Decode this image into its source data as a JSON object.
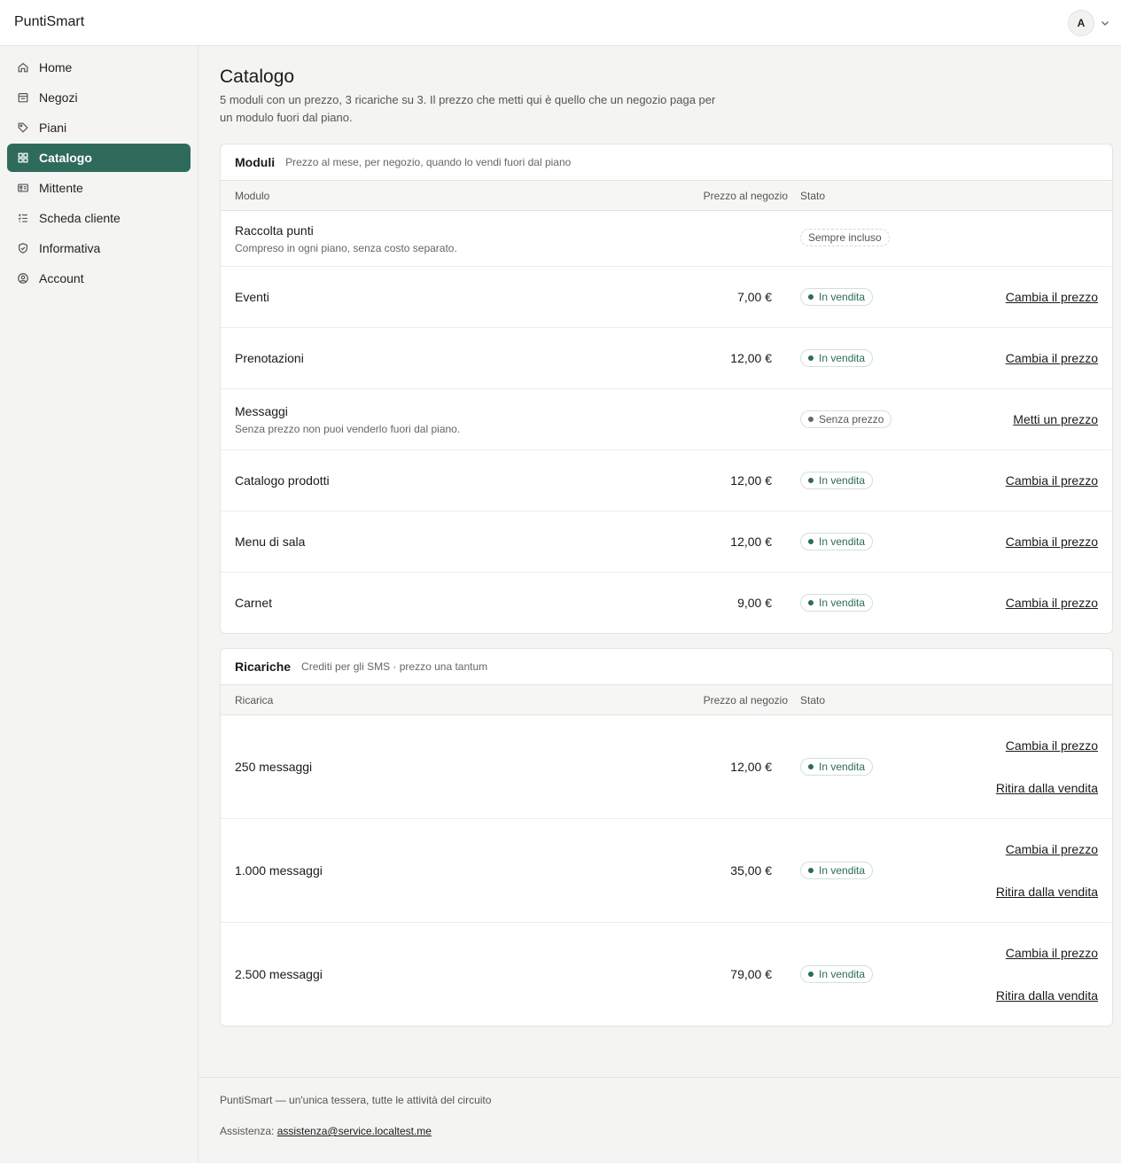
{
  "app": {
    "brand": "PuntiSmart",
    "user_initial": "A"
  },
  "sidebar": {
    "items": [
      {
        "label": "Home",
        "icon": "home-icon",
        "active": false
      },
      {
        "label": "Negozi",
        "icon": "store-icon",
        "active": false
      },
      {
        "label": "Piani",
        "icon": "tag-icon",
        "active": false
      },
      {
        "label": "Catalogo",
        "icon": "grid-icon",
        "active": true
      },
      {
        "label": "Mittente",
        "icon": "id-card-icon",
        "active": false
      },
      {
        "label": "Scheda cliente",
        "icon": "checklist-icon",
        "active": false
      },
      {
        "label": "Informativa",
        "icon": "shield-icon",
        "active": false
      },
      {
        "label": "Account",
        "icon": "user-circle-icon",
        "active": false
      }
    ]
  },
  "page": {
    "title": "Catalogo",
    "subtitle": "5 moduli con un prezzo, 3 ricariche su 3. Il prezzo che metti qui è quello che un negozio paga per un modulo fuori dal piano."
  },
  "modules": {
    "title": "Moduli",
    "description": "Prezzo al mese, per negozio, quando lo vendi fuori dal piano",
    "columns": {
      "name": "Modulo",
      "price": "Prezzo al negozio",
      "status": "Stato"
    },
    "rows": [
      {
        "name": "Raccolta punti",
        "note": "Compreso in ogni piano, senza costo separato.",
        "price": "",
        "status": "Sempre incluso",
        "status_kind": "included",
        "action": ""
      },
      {
        "name": "Eventi",
        "note": "",
        "price": "7,00 €",
        "status": "In vendita",
        "status_kind": "on-sale",
        "action": "Cambia il prezzo"
      },
      {
        "name": "Prenotazioni",
        "note": "",
        "price": "12,00 €",
        "status": "In vendita",
        "status_kind": "on-sale",
        "action": "Cambia il prezzo"
      },
      {
        "name": "Messaggi",
        "note": "Senza prezzo non puoi venderlo fuori dal piano.",
        "price": "",
        "status": "Senza prezzo",
        "status_kind": "no-price",
        "action": "Metti un prezzo"
      },
      {
        "name": "Catalogo prodotti",
        "note": "",
        "price": "12,00 €",
        "status": "In vendita",
        "status_kind": "on-sale",
        "action": "Cambia il prezzo"
      },
      {
        "name": "Menu di sala",
        "note": "",
        "price": "12,00 €",
        "status": "In vendita",
        "status_kind": "on-sale",
        "action": "Cambia il prezzo"
      },
      {
        "name": "Carnet",
        "note": "",
        "price": "9,00 €",
        "status": "In vendita",
        "status_kind": "on-sale",
        "action": "Cambia il prezzo"
      }
    ]
  },
  "topups": {
    "title": "Ricariche",
    "description": "Crediti per gli SMS · prezzo una tantum",
    "columns": {
      "name": "Ricarica",
      "price": "Prezzo al negozio",
      "status": "Stato"
    },
    "rows": [
      {
        "name": "250 messaggi",
        "price": "12,00 €",
        "status": "In vendita",
        "action1": "Cambia il prezzo",
        "action2": "Ritira dalla vendita"
      },
      {
        "name": "1.000 messaggi",
        "price": "35,00 €",
        "status": "In vendita",
        "action1": "Cambia il prezzo",
        "action2": "Ritira dalla vendita"
      },
      {
        "name": "2.500 messaggi",
        "price": "79,00 €",
        "status": "In vendita",
        "action1": "Cambia il prezzo",
        "action2": "Ritira dalla vendita"
      }
    ]
  },
  "footer": {
    "tagline": "PuntiSmart — un'unica tessera, tutte le attività del circuito",
    "support_label": "Assistenza:",
    "support_email": "assistenza@service.localtest.me"
  },
  "colors": {
    "accent": "#2f6b5b",
    "on_sale": "#2d6b56",
    "muted": "#666666"
  }
}
